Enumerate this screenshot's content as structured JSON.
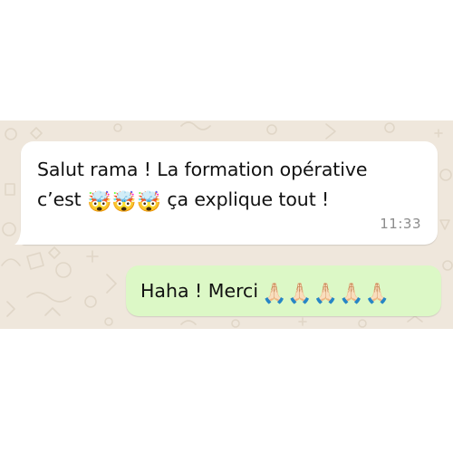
{
  "conversation": {
    "background_color": "#efe7dc",
    "incoming": {
      "line1": "Salut rama ! La formation opérative",
      "line2_prefix": "c’est",
      "line2_emojis": "🤯🤯🤯",
      "line2_suffix": "ça explique tout !",
      "time": "11:33",
      "bubble_color": "#ffffff"
    },
    "outgoing": {
      "text": "Haha ! Merci",
      "emojis": "🙏🏻🙏🏻🙏🏻🙏🏻🙏🏻",
      "bubble_color": "#dcf8c6"
    }
  }
}
